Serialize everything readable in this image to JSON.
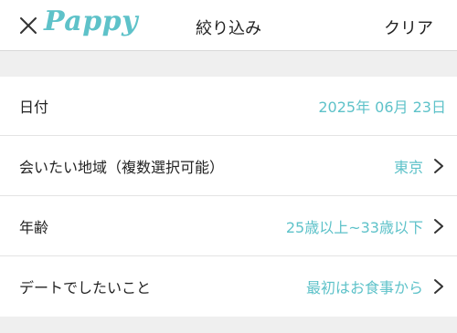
{
  "colors": {
    "brand": "#5ec2c9",
    "text": "#222222",
    "chevron": "#333333"
  },
  "header": {
    "close_icon": "close-icon",
    "logo_text": "Pappy",
    "title": "絞り込み",
    "clear_label": "クリア"
  },
  "filters": [
    {
      "label": "日付",
      "value": "2025年 06月 23日"
    },
    {
      "label": "会いたい地域（複数選択可能）",
      "value": "東京",
      "icon": "chevron-right-icon"
    },
    {
      "label": "年齢",
      "value": "25歳以上~33歳以下",
      "icon": "chevron-right-icon"
    },
    {
      "label": "デートでしたいこと",
      "value": "最初はお食事から",
      "icon": "chevron-right-icon"
    }
  ]
}
